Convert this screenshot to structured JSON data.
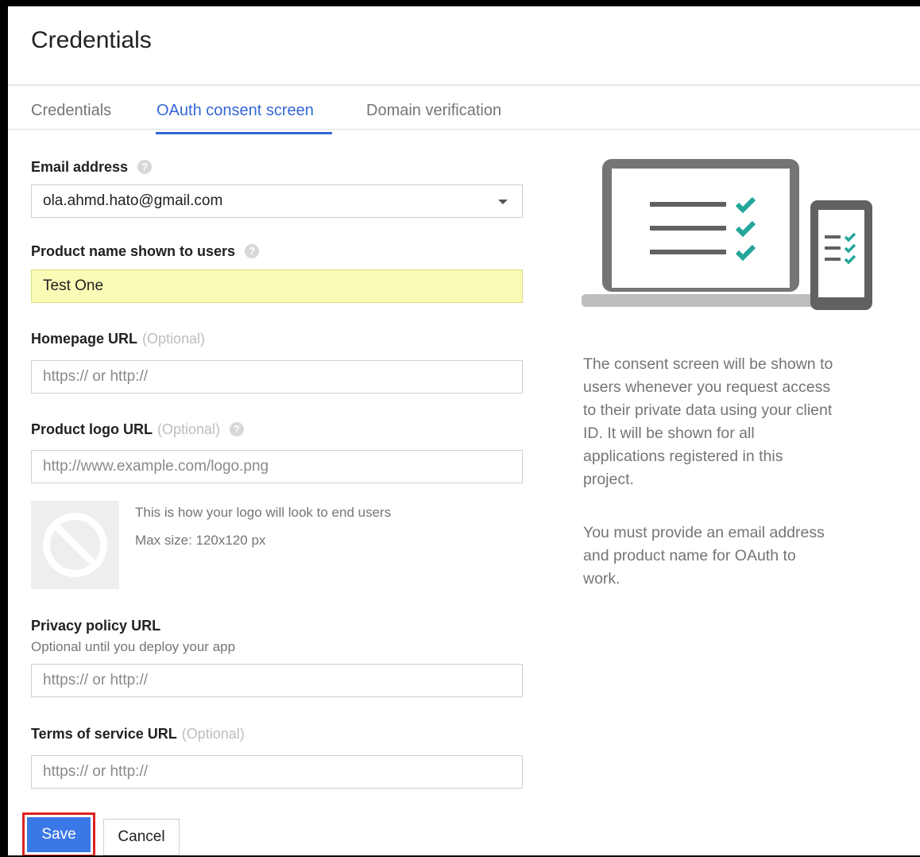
{
  "page": {
    "title": "Credentials"
  },
  "tabs": [
    {
      "label": "Credentials",
      "active": false
    },
    {
      "label": "OAuth consent screen",
      "active": true
    },
    {
      "label": "Domain verification",
      "active": false
    }
  ],
  "form": {
    "email": {
      "label": "Email address",
      "value": "ola.ahmd.hato@gmail.com"
    },
    "product_name": {
      "label": "Product name shown to users",
      "value": "Test One"
    },
    "homepage": {
      "label": "Homepage URL",
      "optional": "(Optional)",
      "placeholder": "https:// or http://"
    },
    "logo": {
      "label": "Product logo URL",
      "optional": "(Optional)",
      "placeholder": "http://www.example.com/logo.png",
      "hint": "This is how your logo will look to end users",
      "max_size": "Max size: 120x120 px"
    },
    "privacy": {
      "label": "Privacy policy URL",
      "sublabel": "Optional until you deploy your app",
      "placeholder": "https:// or http://"
    },
    "terms": {
      "label": "Terms of service URL",
      "optional": "(Optional)",
      "placeholder": "https:// or http://"
    }
  },
  "side": {
    "desc1": [
      "The consent screen will be shown to",
      "users whenever you request access",
      "to their private data using your client",
      "ID. It will be shown for all",
      "applications registered in this",
      "project."
    ],
    "desc2": [
      "You must provide an email address",
      "and product name for OAuth to",
      "work."
    ]
  },
  "buttons": {
    "save": "Save",
    "cancel": "Cancel"
  },
  "colors": {
    "accent": "#3367d6",
    "save_button": "#3b78e7",
    "highlight_field": "#f9fbb6",
    "check": "#26a69a",
    "annotation_box": "#e0201f"
  }
}
